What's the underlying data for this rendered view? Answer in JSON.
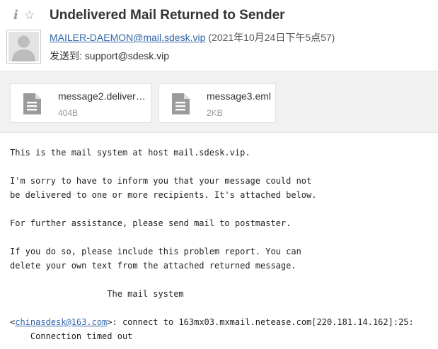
{
  "header": {
    "subject": "Undelivered Mail Returned to Sender",
    "sender_address": "MAILER-DAEMON@mail.sdesk.vip",
    "sender_date": "(2021年10月24日下午5点57)",
    "to_label": "发送到: ",
    "to_address": "support@sdesk.vip",
    "icons": {
      "info": "info-icon",
      "star": "star-icon",
      "avatar": "avatar-icon"
    }
  },
  "attachments": [
    {
      "name": "message2.deliver…",
      "size": "404B",
      "icon": "document-icon"
    },
    {
      "name": "message3.eml",
      "size": "2KB",
      "icon": "document-icon"
    }
  ],
  "body": {
    "p1": "This is the mail system at host mail.sdesk.vip.",
    "p2_l1": "I'm sorry to have to inform you that your message could not",
    "p2_l2": "be delivered to one or more recipients. It's attached below.",
    "p3": "For further assistance, please send mail to postmaster.",
    "p4_l1": "If you do so, please include this problem report. You can",
    "p4_l2": "delete your own text from the attached returned message.",
    "signature": "                   The mail system",
    "recipient_open": "<",
    "recipient_email": "chinasdesk@163.com",
    "recipient_rest": ">: connect to 163mx03.mxmail.netease.com[220.181.14.162]:25:",
    "error_line": "    Connection timed out"
  },
  "colors": {
    "link": "#3366aa",
    "attachment_bar": "#f1f1f1",
    "muted_text": "#999999"
  }
}
